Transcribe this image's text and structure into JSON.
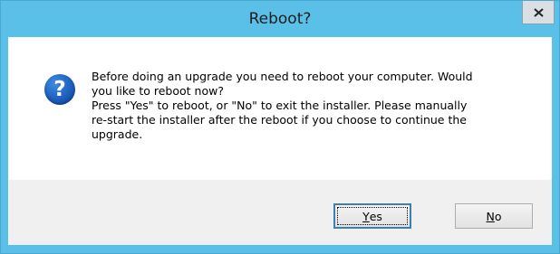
{
  "window": {
    "title": "Reboot?",
    "close_label": "x"
  },
  "dialog": {
    "icon": "question-icon",
    "message": "Before doing an upgrade you need to reboot your computer.  Would\nyou like to reboot now?\nPress \"Yes\" to reboot, or \"No\" to exit the installer.  Please manually\nre-start the installer after the reboot if you choose to continue the\nupgrade."
  },
  "buttons": {
    "yes": {
      "accel": "Y",
      "rest": "es"
    },
    "no": {
      "accel": "N",
      "rest": "o"
    }
  },
  "colors": {
    "titlebar": "#5bc0e8",
    "content_bg": "#ffffff",
    "footer_bg": "#f0f0f0",
    "icon_blue": "#1d5fbd"
  }
}
